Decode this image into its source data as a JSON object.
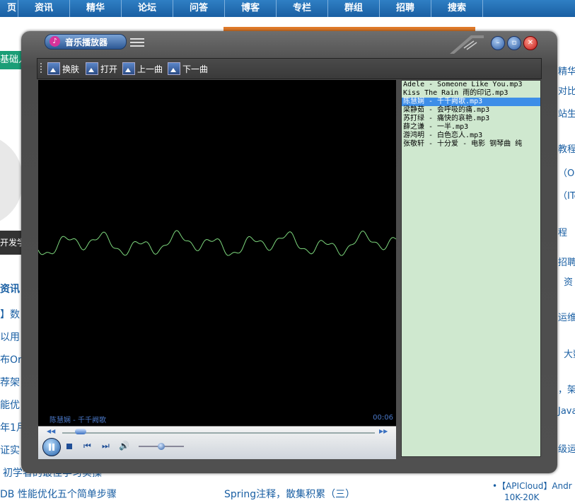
{
  "background_page": {
    "nav": [
      "页",
      "资讯",
      "精华",
      "论坛",
      "问答",
      "博客",
      "专栏",
      "群组",
      "招聘",
      "搜索"
    ],
    "left_snippets": [
      "基础入",
      "开发学",
      "资讯",
      "】数",
      "以用",
      "布Or",
      "荐架",
      "能优",
      "年1月",
      "证实"
    ],
    "right_snippets": [
      "精华文",
      "对比",
      "站生命",
      "教程",
      "（Or",
      "（ITe",
      "程",
      "招聘",
      "资",
      "运维",
      "大数",
      "，架",
      "Java",
      "级运维"
    ],
    "bottom_left": "DB 性能优化五个简单步骤",
    "bottom_middle": "Spring注释，散集积累（三）",
    "bottom_right_1": "•【APICloud】Andr",
    "bottom_right_2": "10K-20K",
    "bottom_partial": "初学者的最佳学习实操"
  },
  "player": {
    "title": "音乐播放器",
    "icon": "music-note-icon",
    "toolbar": [
      {
        "label": "换肤"
      },
      {
        "label": "打开"
      },
      {
        "label": "上一曲"
      },
      {
        "label": "下一曲"
      }
    ],
    "now_playing": "陈慧娴 - 千千阙歌",
    "elapsed": "00:06",
    "progress_fraction": 0.04,
    "volume_fraction": 0.5,
    "playlist": [
      {
        "name": "Adele - Someone Like You.mp3",
        "selected": false
      },
      {
        "name": "Kiss The Rain 雨的印记.mp3",
        "selected": false
      },
      {
        "name": "陈慧娴 - 千千阙歌.mp3",
        "selected": true
      },
      {
        "name": "梁静茹 - 会呼吸的痛.mp3",
        "selected": false
      },
      {
        "name": "苏打绿 - 痛快的哀艳.mp3",
        "selected": false
      },
      {
        "name": "薛之谦 - 一半.mp3",
        "selected": false
      },
      {
        "name": "游鸿明 - 白色恋人.mp3",
        "selected": false
      },
      {
        "name": "张敬轩 - 十分爱 - 电影 钢琴曲 纯",
        "selected": false
      }
    ],
    "colors": {
      "waveform": "#7dd87d",
      "playlist_bg": "#cfe8cf",
      "selection": "#3d8ee8"
    }
  }
}
